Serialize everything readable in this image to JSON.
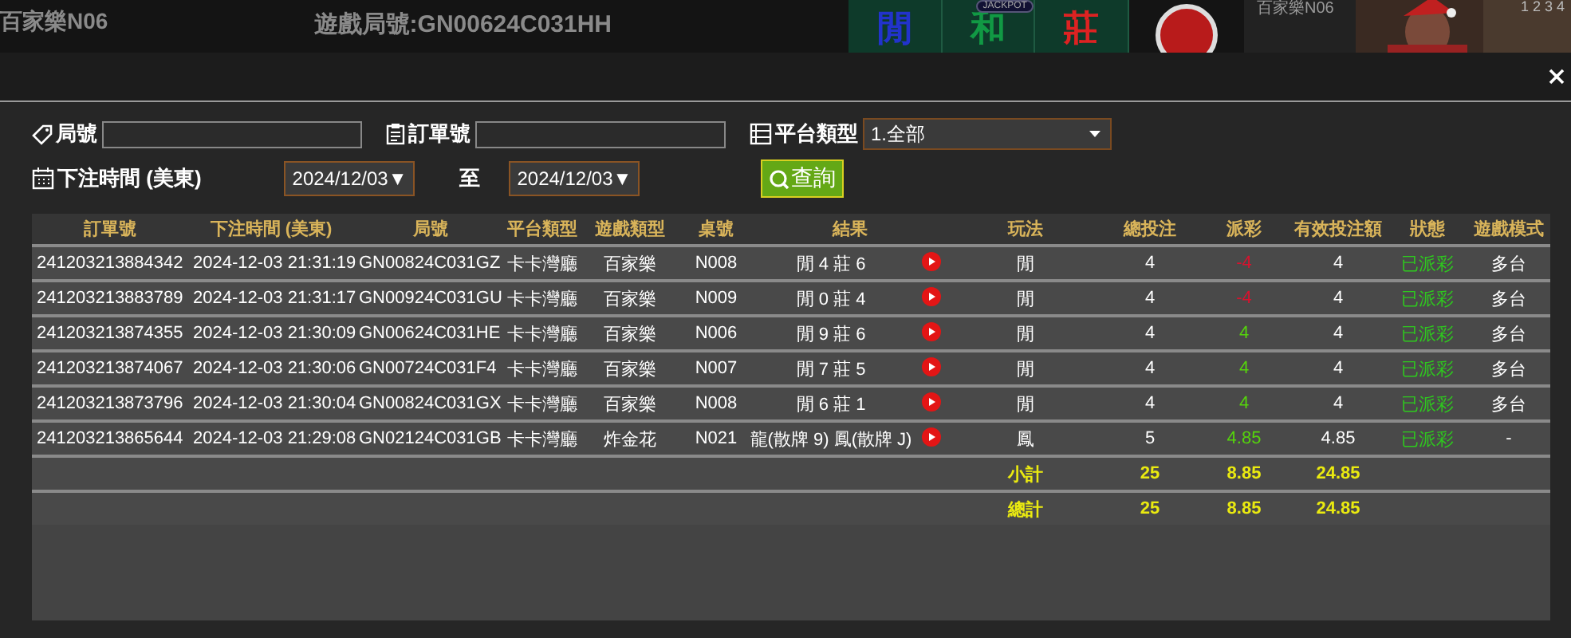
{
  "backdrop": {
    "table_name": "百家樂N06",
    "round_label": "遊戲局號:GN00624C031HH",
    "bet_areas": [
      {
        "label": "閒",
        "color": "#2233cc"
      },
      {
        "label": "和",
        "color": "#119944"
      },
      {
        "label": "莊",
        "color": "#dd2222"
      }
    ],
    "jackpot": "JACKPOT",
    "side_table_name": "百家樂N06",
    "road_numbers": "1 2 3 4"
  },
  "filters": {
    "round_label": "局號",
    "order_label": "訂單號",
    "platform_label": "平台類型",
    "platform_value": "1.全部",
    "time_label": "下注時間 (美東)",
    "date_from": "2024/12/03▼",
    "to_label": "至",
    "date_to": "2024/12/03▼",
    "search_button": "查詢"
  },
  "table": {
    "columns": [
      "訂單號",
      "下注時間 (美東)",
      "局號",
      "平台類型",
      "遊戲類型",
      "桌號",
      "結果",
      "玩法",
      "總投注",
      "派彩",
      "有效投注額",
      "狀態",
      "遊戲模式"
    ],
    "rows": [
      {
        "order": "241203213884342",
        "time": "2024-12-03 21:31:19",
        "round": "GN00824C031GZ",
        "platform": "卡卡灣廳",
        "game": "百家樂",
        "table_no": "N008",
        "result": "閒 4 莊 6",
        "play": "閒",
        "bet": "4",
        "payout": {
          "text": "-4",
          "color": "#d8122e"
        },
        "valid_bet": "4",
        "status": "已派彩",
        "mode": "多台"
      },
      {
        "order": "241203213883789",
        "time": "2024-12-03 21:31:17",
        "round": "GN00924C031GU",
        "platform": "卡卡灣廳",
        "game": "百家樂",
        "table_no": "N009",
        "result": "閒 0 莊 4",
        "play": "閒",
        "bet": "4",
        "payout": {
          "text": "-4",
          "color": "#d8122e"
        },
        "valid_bet": "4",
        "status": "已派彩",
        "mode": "多台"
      },
      {
        "order": "241203213874355",
        "time": "2024-12-03 21:30:09",
        "round": "GN00624C031HE",
        "platform": "卡卡灣廳",
        "game": "百家樂",
        "table_no": "N006",
        "result": "閒 9 莊 6",
        "play": "閒",
        "bet": "4",
        "payout": {
          "text": "4",
          "color": "#55d40c"
        },
        "valid_bet": "4",
        "status": "已派彩",
        "mode": "多台"
      },
      {
        "order": "241203213874067",
        "time": "2024-12-03 21:30:06",
        "round": "GN00724C031F4",
        "platform": "卡卡灣廳",
        "game": "百家樂",
        "table_no": "N007",
        "result": "閒 7 莊 5",
        "play": "閒",
        "bet": "4",
        "payout": {
          "text": "4",
          "color": "#55d40c"
        },
        "valid_bet": "4",
        "status": "已派彩",
        "mode": "多台"
      },
      {
        "order": "241203213873796",
        "time": "2024-12-03 21:30:04",
        "round": "GN00824C031GX",
        "platform": "卡卡灣廳",
        "game": "百家樂",
        "table_no": "N008",
        "result": "閒 6 莊 1",
        "play": "閒",
        "bet": "4",
        "payout": {
          "text": "4",
          "color": "#55d40c"
        },
        "valid_bet": "4",
        "status": "已派彩",
        "mode": "多台"
      },
      {
        "order": "241203213865644",
        "time": "2024-12-03 21:29:08",
        "round": "GN02124C031GB",
        "platform": "卡卡灣廳",
        "game": "炸金花",
        "table_no": "N021",
        "result": "龍(散牌 9) 鳳(散牌 J)",
        "play": "鳳",
        "bet": "5",
        "payout": {
          "text": "4.85",
          "color": "#55d40c"
        },
        "valid_bet": "4.85",
        "status": "已派彩",
        "mode": "-"
      }
    ],
    "totals": [
      {
        "label": "小計",
        "bet": "25",
        "payout": "8.85",
        "valid_bet": "24.85"
      },
      {
        "label": "總計",
        "bet": "25",
        "payout": "8.85",
        "valid_bet": "24.85"
      }
    ]
  }
}
